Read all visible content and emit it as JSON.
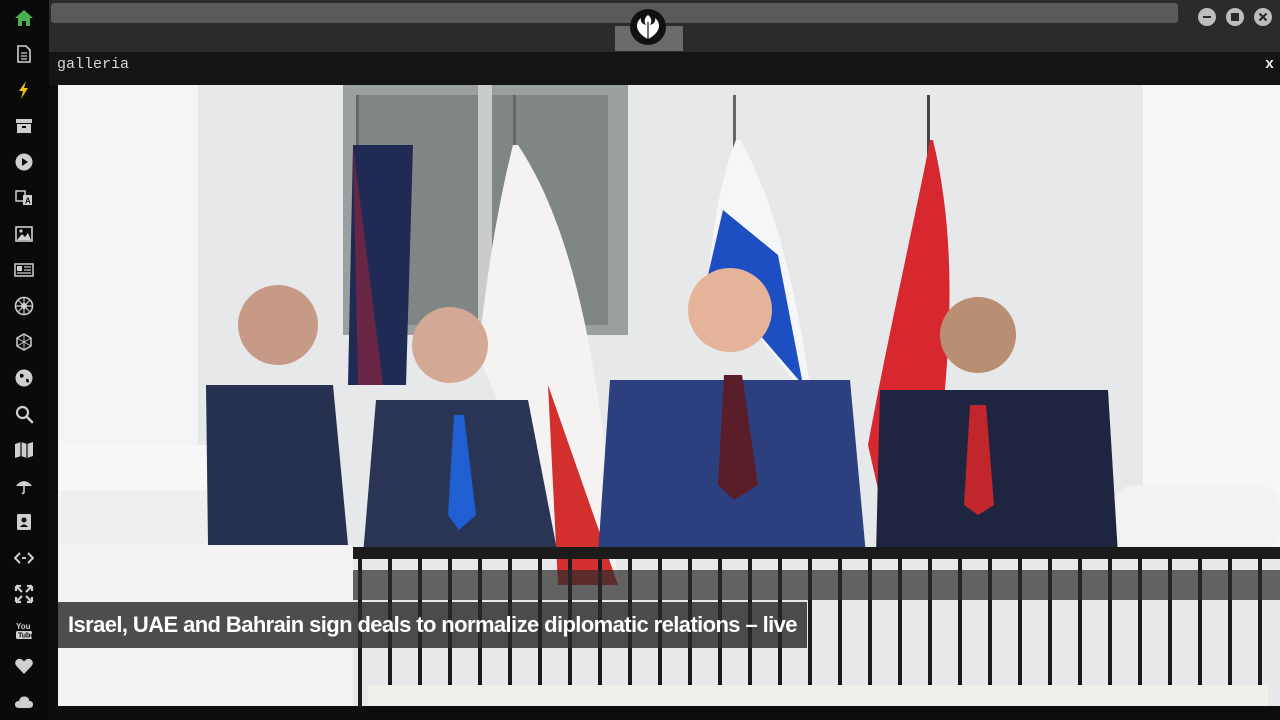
{
  "sidebar": {
    "items": [
      {
        "icon": "home-icon",
        "color": "#4caf50"
      },
      {
        "icon": "document-icon"
      },
      {
        "icon": "lightning-icon"
      },
      {
        "icon": "archive-icon"
      },
      {
        "icon": "play-icon"
      },
      {
        "icon": "translate-icon"
      },
      {
        "icon": "image-icon"
      },
      {
        "icon": "newspaper-icon"
      },
      {
        "icon": "empire-icon"
      },
      {
        "icon": "hexagon-network-icon"
      },
      {
        "icon": "globe-icon"
      },
      {
        "icon": "search-icon"
      },
      {
        "icon": "map-icon"
      },
      {
        "icon": "umbrella-icon"
      },
      {
        "icon": "contact-book-icon"
      },
      {
        "icon": "code-icon"
      },
      {
        "icon": "expand-icon"
      },
      {
        "icon": "youtube-icon"
      },
      {
        "icon": "heart-icon"
      },
      {
        "icon": "cloud-icon"
      }
    ]
  },
  "topbar": {
    "logo": "rebel-alliance-icon"
  },
  "panel": {
    "title": "galleria",
    "close_label": "x"
  },
  "gallery": {
    "caption": "Israel, UAE and Bahrain sign deals to normalize diplomatic relations – live"
  }
}
